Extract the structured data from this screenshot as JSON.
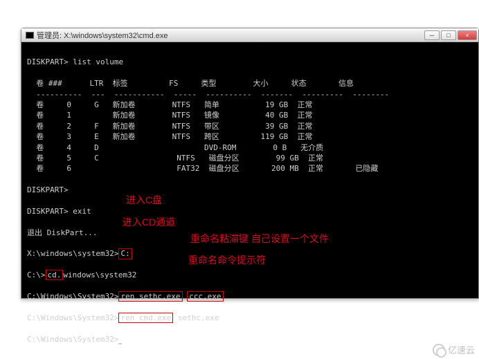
{
  "window": {
    "title": "管理员: X:\\windows\\system32\\cmd.exe",
    "minimize": "─",
    "maximize": "□",
    "close": "×"
  },
  "terminal": {
    "line1": "DISKPART> list volume",
    "header": "  卷 ###      LTR  标签         FS     类型        大小     状态       信息",
    "divider": "  ----------  ---  -----------  -----  ----------  -------  ---------  --------",
    "rows": [
      "  卷     0     G   新加卷        NTFS   简单          19 GB  正常",
      "  卷     1         新加卷        NTFS   镜像          40 GB  正常",
      "  卷     2     F   新加卷        NTFS   带区          39 GB  正常",
      "  卷     3     E   新加卷        NTFS   跨区         119 GB  正常",
      "  卷     4     D                       DVD-ROM        0 B   无介质",
      "  卷     5     C                 NTFS   磁盘分区        99 GB  正常",
      "  卷     6                       FAT32  磁盘分区       200 MB  正常       已隐藏"
    ],
    "prompt2": "DISKPART>",
    "exitcmd": "DISKPART> exit",
    "exitmsg": "退出 DiskPart...",
    "p_x": "X:\\windows\\system32>",
    "p_x_cmd": "C:",
    "p_c1": "C:\\>",
    "p_c1_cmd_a": "cd.",
    "p_c1_cmd_b": "windows\\system32",
    "p_c2": "C:\\Windows\\System32>",
    "p_c2_a": "ren sethc.exe",
    "p_c2_b": "ccc.exe",
    "p_c3": "C:\\Windows\\System32>",
    "p_c3_a": "ren cmd.exe",
    "p_c3_b": "sethc.exe",
    "p_c4": "C:\\Windows\\System32>"
  },
  "annotations": {
    "a1": "进入C盘",
    "a2": "进入CD通道",
    "a3": "重命名粘滞键  自己设置一个文件",
    "a4": "重命名命令提示符"
  },
  "watermark": "亿速云"
}
